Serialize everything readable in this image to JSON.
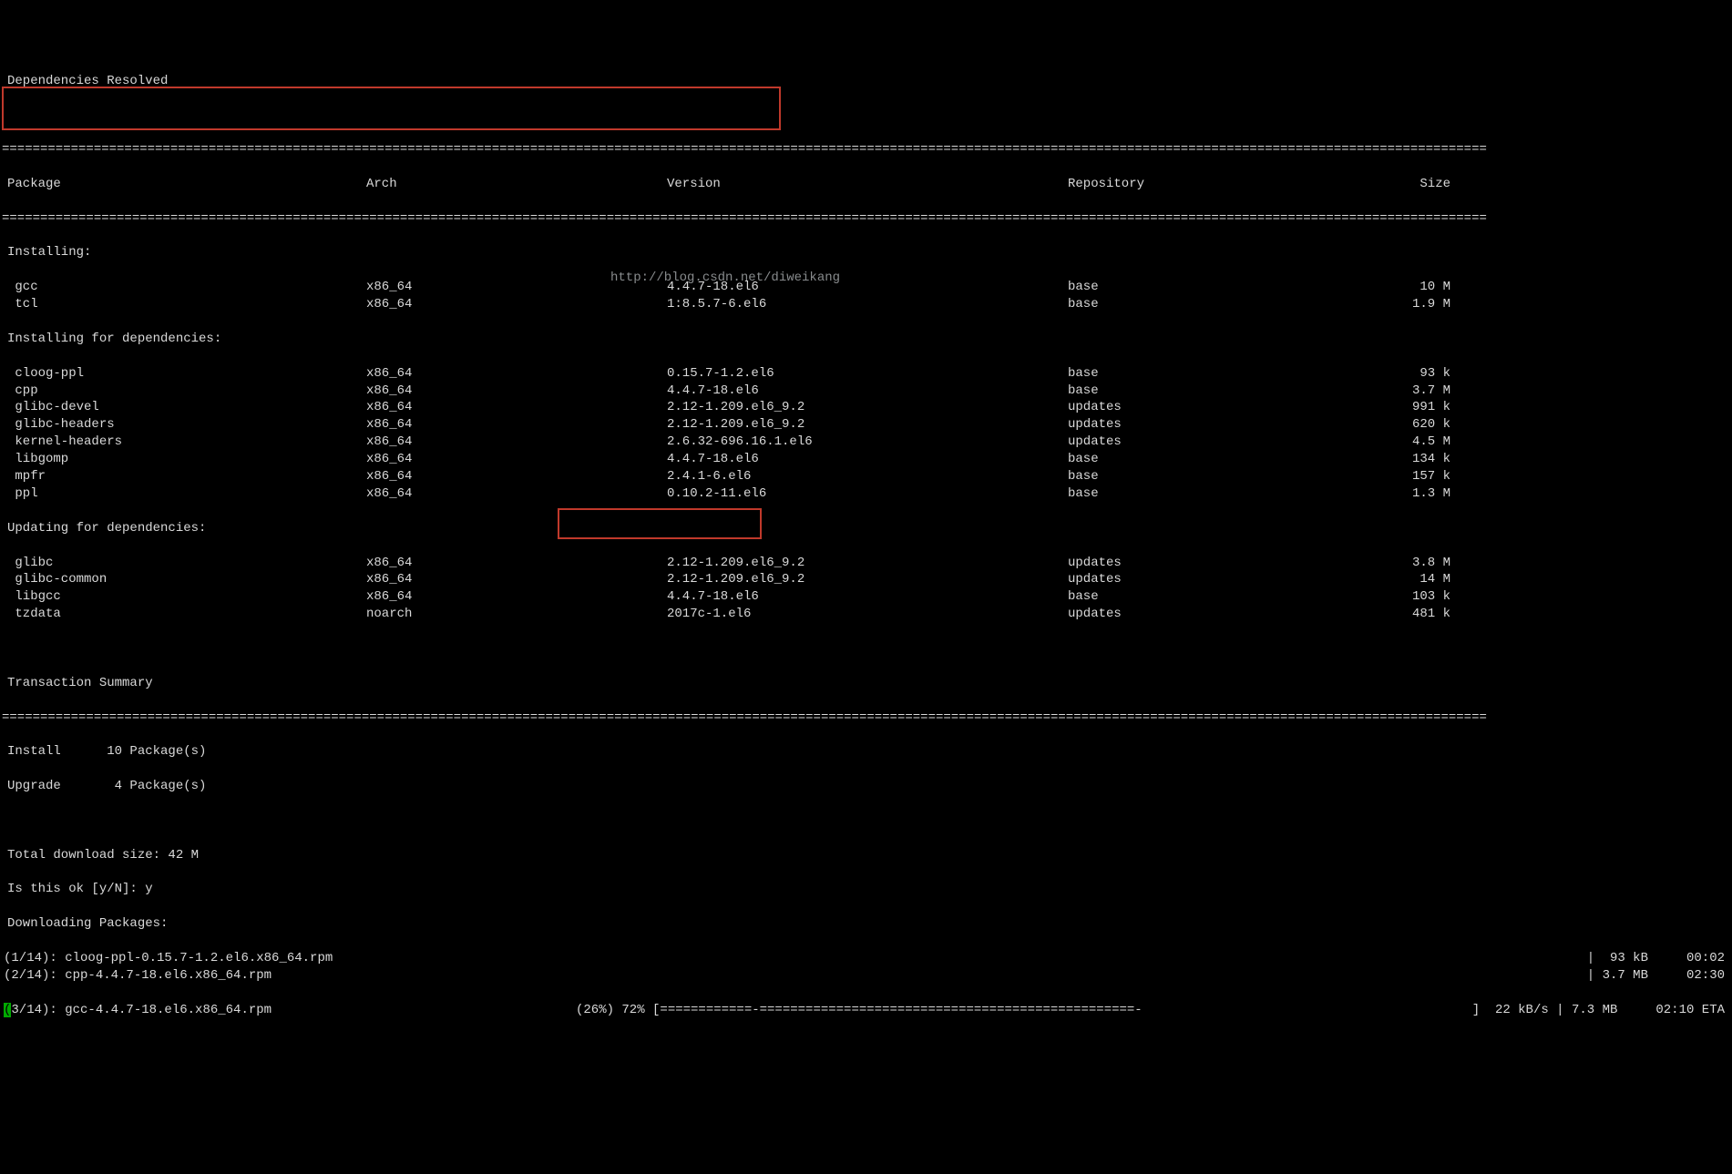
{
  "title": "Dependencies Resolved",
  "divider": "==================================================================================================================================================================================================",
  "headers": {
    "pkg": "Package",
    "arch": "Arch",
    "ver": "Version",
    "repo": "Repository",
    "size": "Size"
  },
  "sections": {
    "installing": "Installing:",
    "installing_deps": "Installing for dependencies:",
    "updating_deps": "Updating for dependencies:"
  },
  "install": [
    {
      "pkg": "gcc",
      "arch": "x86_64",
      "ver": "4.4.7-18.el6",
      "repo": "base",
      "size": "10 M"
    },
    {
      "pkg": "tcl",
      "arch": "x86_64",
      "ver": "1:8.5.7-6.el6",
      "repo": "base",
      "size": "1.9 M"
    }
  ],
  "install_deps": [
    {
      "pkg": "cloog-ppl",
      "arch": "x86_64",
      "ver": "0.15.7-1.2.el6",
      "repo": "base",
      "size": "93 k"
    },
    {
      "pkg": "cpp",
      "arch": "x86_64",
      "ver": "4.4.7-18.el6",
      "repo": "base",
      "size": "3.7 M"
    },
    {
      "pkg": "glibc-devel",
      "arch": "x86_64",
      "ver": "2.12-1.209.el6_9.2",
      "repo": "updates",
      "size": "991 k"
    },
    {
      "pkg": "glibc-headers",
      "arch": "x86_64",
      "ver": "2.12-1.209.el6_9.2",
      "repo": "updates",
      "size": "620 k"
    },
    {
      "pkg": "kernel-headers",
      "arch": "x86_64",
      "ver": "2.6.32-696.16.1.el6",
      "repo": "updates",
      "size": "4.5 M"
    },
    {
      "pkg": "libgomp",
      "arch": "x86_64",
      "ver": "4.4.7-18.el6",
      "repo": "base",
      "size": "134 k"
    },
    {
      "pkg": "mpfr",
      "arch": "x86_64",
      "ver": "2.4.1-6.el6",
      "repo": "base",
      "size": "157 k"
    },
    {
      "pkg": "ppl",
      "arch": "x86_64",
      "ver": "0.10.2-11.el6",
      "repo": "base",
      "size": "1.3 M"
    }
  ],
  "update_deps": [
    {
      "pkg": "glibc",
      "arch": "x86_64",
      "ver": "2.12-1.209.el6_9.2",
      "repo": "updates",
      "size": "3.8 M"
    },
    {
      "pkg": "glibc-common",
      "arch": "x86_64",
      "ver": "2.12-1.209.el6_9.2",
      "repo": "updates",
      "size": "14 M"
    },
    {
      "pkg": "libgcc",
      "arch": "x86_64",
      "ver": "4.4.7-18.el6",
      "repo": "base",
      "size": "103 k"
    },
    {
      "pkg": "tzdata",
      "arch": "noarch",
      "ver": "2017c-1.el6",
      "repo": "updates",
      "size": "481 k"
    }
  ],
  "tx_summary": "Transaction Summary",
  "summary_install": "Install      10 Package(s)",
  "summary_upgrade": "Upgrade       4 Package(s)",
  "total_dl": "Total download size: 42 M",
  "confirm": "Is this ok [y/N]: y",
  "downloading": "Downloading Packages:",
  "dl": [
    {
      "left": "(1/14): cloog-ppl-0.15.7-1.2.el6.x86_64.rpm",
      "right": "|  93 kB     00:02"
    },
    {
      "left": "(2/14): cpp-4.4.7-18.el6.x86_64.rpm",
      "right": "| 3.7 MB     02:30"
    }
  ],
  "progress": {
    "left_prefix_inverse": "(",
    "left_rest": "3/14): gcc-4.4.7-18.el6.x86_64.rpm",
    "mid": "(26%) 72% [============-=================================================- ",
    "right": "]  22 kB/s | 7.3 MB     02:10 ETA"
  },
  "watermark": "http://blog.csdn.net/diweikang"
}
